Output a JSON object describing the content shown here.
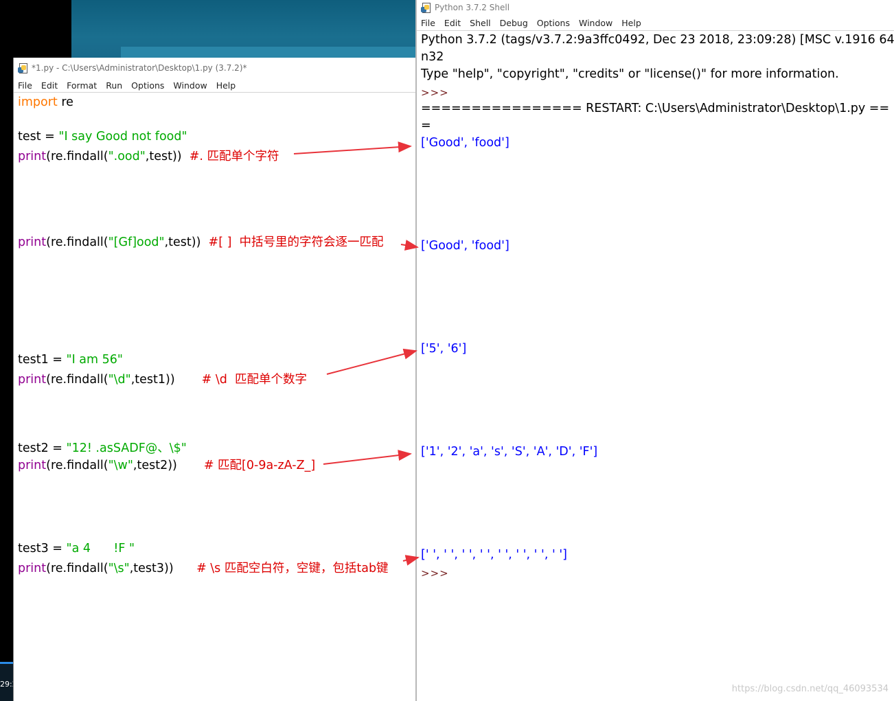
{
  "editor": {
    "title": "*1.py - C:\\Users\\Administrator\\Desktop\\1.py (3.7.2)*",
    "menu": [
      "File",
      "Edit",
      "Format",
      "Run",
      "Options",
      "Window",
      "Help"
    ],
    "code": {
      "l1_kw": "import",
      "l1_rest": " re",
      "l2_a": "test = ",
      "l2_str": "\"I say Good not food\"",
      "l3_fn": "print",
      "l3_a": "(re.findall(",
      "l3_str": "\".ood\"",
      "l3_b": ",test))  ",
      "l3_cm": "#. 匹配单个字符",
      "l4_fn": "print",
      "l4_a": "(re.findall(",
      "l4_str": "\"[Gf]ood\"",
      "l4_b": ",test))  ",
      "l4_cm": "#[ ]  中括号里的字符会逐一匹配",
      "l5_a": "test1 = ",
      "l5_str": "\"I am 56\"",
      "l6_fn": "print",
      "l6_a": "(re.findall(",
      "l6_str": "\"\\d\"",
      "l6_b": ",test1))       ",
      "l6_cm": "# \\d  匹配单个数字",
      "l7_a": "test2 = ",
      "l7_str": "\"12! .asSADF@、\\$\"",
      "l8_fn": "print",
      "l8_a": "(re.findall(",
      "l8_str": "\"\\w\"",
      "l8_b": ",test2))       ",
      "l8_cm": "# 匹配[0-9a-zA-Z_]",
      "l9_a": "test3 = ",
      "l9_str": "\"a 4      !F \"",
      "l10_fn": "print",
      "l10_a": "(re.findall(",
      "l10_str": "\"\\s\"",
      "l10_b": ",test3))      ",
      "l10_cm": "# \\s 匹配空白符，空键，包括tab键"
    }
  },
  "shell": {
    "title": "Python 3.7.2 Shell",
    "menu": [
      "File",
      "Edit",
      "Shell",
      "Debug",
      "Options",
      "Window",
      "Help"
    ],
    "banner1": "Python 3.7.2 (tags/v3.7.2:9a3ffc0492, Dec 23 2018, 23:09:28) [MSC v.1916 64",
    "banner2": "n32",
    "banner3": "Type \"help\", \"copyright\", \"credits\" or \"license()\" for more information.",
    "prompt": ">>>",
    "restart": "================ RESTART: C:\\Users\\Administrator\\Desktop\\1.py ==",
    "restart_wrap": "=",
    "out1": "['Good', 'food']",
    "out2": "['Good', 'food']",
    "out3": "['5', '6']",
    "out4": "['1', '2', 'a', 's', 'S', 'A', 'D', 'F']",
    "out5": "[' ', ' ', ' ', ' ', ' ', ' ', ' ', ' ']",
    "prompt_end": ">>>"
  },
  "desktop": {
    "clock_fragment": "29:2"
  },
  "watermark": "https://blog.csdn.net/qq_46093534",
  "colors": {
    "keyword": "#ff7700",
    "builtin": "#900090",
    "string": "#00aa00",
    "comment": "#dd0000",
    "output": "#0000ff",
    "arrow": "#e8333a"
  }
}
